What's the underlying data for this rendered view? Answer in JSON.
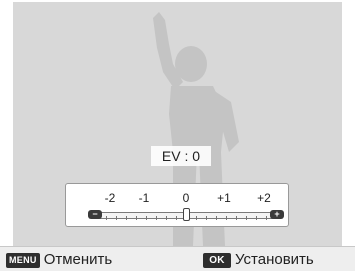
{
  "ev_dialog": {
    "value_label": "EV : 0",
    "current_value": 0,
    "min": -2,
    "max": 2,
    "scale_labels": [
      "-2",
      "-1",
      "0",
      "+1",
      "+2"
    ],
    "minus_symbol": "−",
    "plus_symbol": "+"
  },
  "softkeys": {
    "menu_key": "MENU",
    "cancel_label": "Отменить",
    "ok_key": "OK",
    "set_label": "Установить"
  },
  "colors": {
    "background": "#d8d8d8",
    "silhouette": "#c4c4c4",
    "bar": "#eeeeee"
  }
}
